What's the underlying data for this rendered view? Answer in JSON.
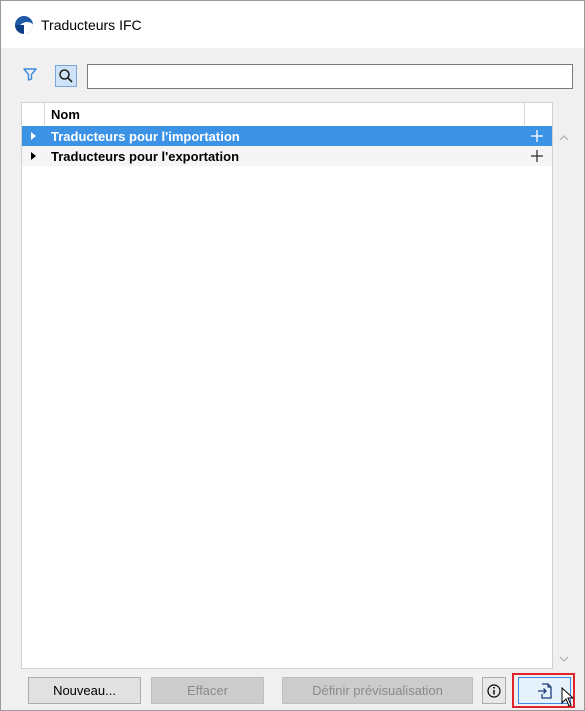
{
  "window": {
    "title": "Traducteurs IFC"
  },
  "toolbar": {
    "filter_icon": "filter-icon",
    "search_icon": "search-icon",
    "search_value": "",
    "search_placeholder": ""
  },
  "list": {
    "column_header": "Nom",
    "rows": [
      {
        "label": "Traducteurs pour l'importation",
        "selected": true,
        "expanded": false
      },
      {
        "label": "Traducteurs pour l'exportation",
        "selected": false,
        "expanded": false
      }
    ]
  },
  "buttons": {
    "new_label": "Nouveau...",
    "delete_label": "Effacer",
    "preview_label": "Définir prévisualisation",
    "info_icon": "info-icon",
    "import_icon": "import-icon"
  },
  "colors": {
    "selection": "#3c93e6",
    "highlight": "#e0242b",
    "accent": "#1e5aa8"
  }
}
